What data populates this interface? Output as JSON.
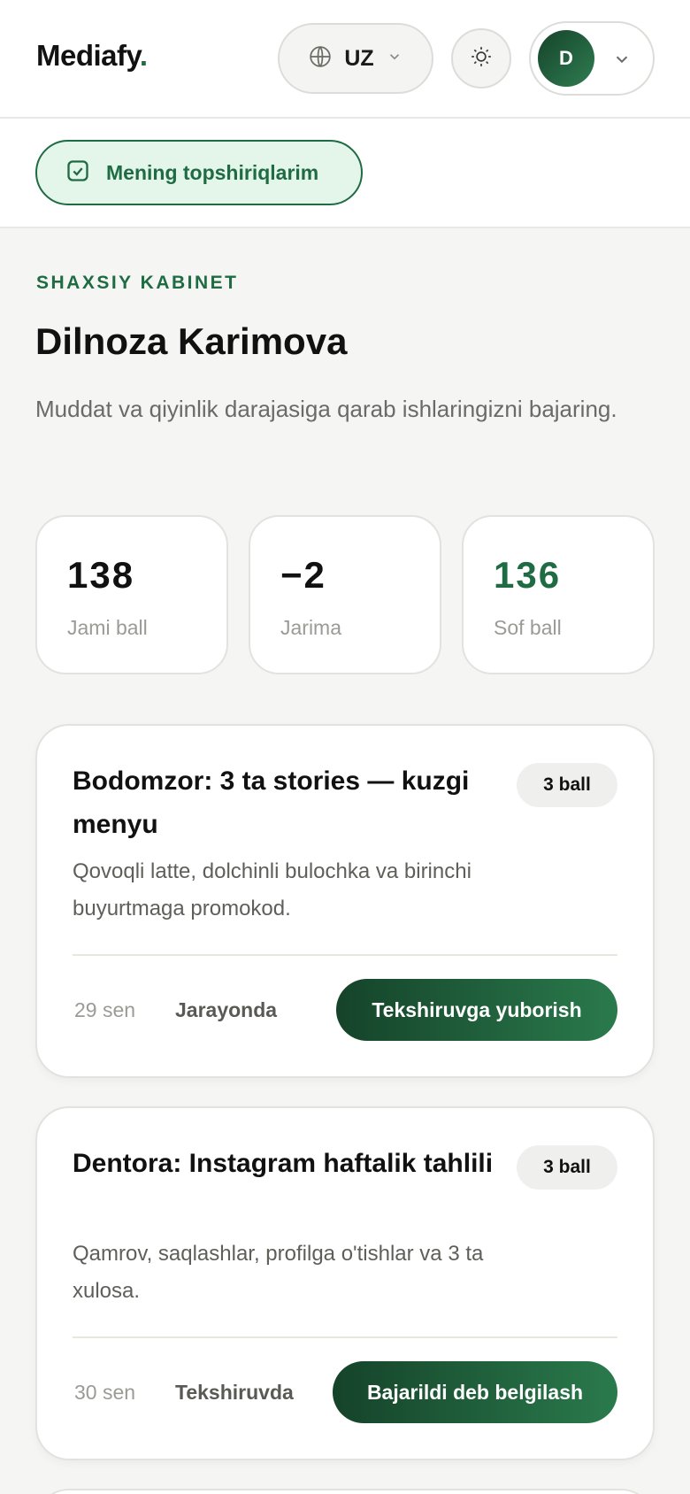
{
  "header": {
    "logo_text": "Mediafy",
    "logo_dot": ".",
    "language": {
      "code": "UZ",
      "icon": "globe-icon",
      "chevron": "chevron-down-icon"
    },
    "theme_icon": "sun-icon",
    "profile": {
      "initial": "D",
      "chevron": "chevron-down-icon"
    }
  },
  "subnav": {
    "tasks_label": "Mening topshiriqlarim",
    "tasks_icon": "checkbox-icon"
  },
  "main": {
    "eyebrow": "SHAXSIY KABINET",
    "title": "Dilnoza Karimova",
    "description": "Muddat va qiyinlik darajasiga qarab ishlaringizni bajaring."
  },
  "stats": [
    {
      "value": "138",
      "label": "Jami ball",
      "color": "#111111"
    },
    {
      "value": "−2",
      "label": "Jarima",
      "color": "#111111"
    },
    {
      "value": "136",
      "label": "Sof ball",
      "color": "#1f6b43"
    }
  ],
  "tasks": [
    {
      "title": "Bodomzor: 3 ta stories — kuzgi menyu",
      "points": "3 ball",
      "description": "Qovoqli latte, dolchinli bulochka va birinchi buyurtmaga promokod.",
      "date": "29 sen",
      "status": "Jarayonda",
      "action": "Tekshiruvga yuborish"
    },
    {
      "title": "Dentora: Instagram haftalik tahlili",
      "points": "3 ball",
      "description": "Qamrov, saqlashlar, profilga o'tishlar va 3 ta xulosa.",
      "date": "30 sen",
      "status": "Tekshiruvda",
      "action": "Bajarildi deb belgilash"
    }
  ],
  "colors": {
    "brand": "#1f6b43",
    "brand_dark": "#15432a",
    "pill_bg": "#e4f5ea",
    "page_bg": "#f5f5f4"
  }
}
